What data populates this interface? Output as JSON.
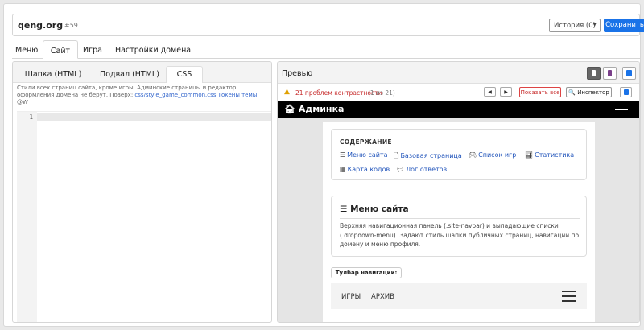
{
  "header": {
    "site_title": "qeng.org",
    "site_id": "#59",
    "history_label": "История (0)",
    "save_label": "Сохранить"
  },
  "main_tabs": [
    "Меню",
    "Сайт",
    "Игра",
    "Настройки домена"
  ],
  "active_main_tab": "Сайт",
  "editor": {
    "tabs": [
      "Шапка (HTML)",
      "Подвал (HTML)",
      "CSS"
    ],
    "active_tab": "CSS",
    "hint_text": "Стили всех страниц сайта, кроме игры. Админские страницы и редактор оформления домена не берут. Поверх:",
    "hint_link": "css/style_game_common.css",
    "hint_tokens": "Токены темы",
    "hint_icon": "@W",
    "line_number": "1"
  },
  "preview": {
    "title": "Превью",
    "contrast_warning": "21 проблем контрастности",
    "contrast_count": "(1 из 21)",
    "prev_glyph": "◀",
    "next_glyph": "▶",
    "show_all_label": "Показать все",
    "inspector_label": "Инспектор",
    "admin_brand": "Админка",
    "toc": {
      "title": "СОДЕРЖАНИЕ",
      "links": [
        "Меню сайта",
        "Базовая страница",
        "Список игр",
        "Статистика",
        "Карта кодов",
        "Лог ответов"
      ]
    },
    "menu_card": {
      "title": "Меню сайта",
      "description": "Верхняя навигационная панель (.site-navbar) и выпадающие списки (.dropdown-menu). Задают стиль шапки публичных страниц, навигации по домену и меню профиля."
    },
    "toolbar_badge": "Тулбар навигации:",
    "site_nav_items": [
      "ИГРЫ",
      "АРХИВ"
    ]
  },
  "colors": {
    "accent": "#1a73e8",
    "warning": "#c62828",
    "link": "#2255bb"
  }
}
